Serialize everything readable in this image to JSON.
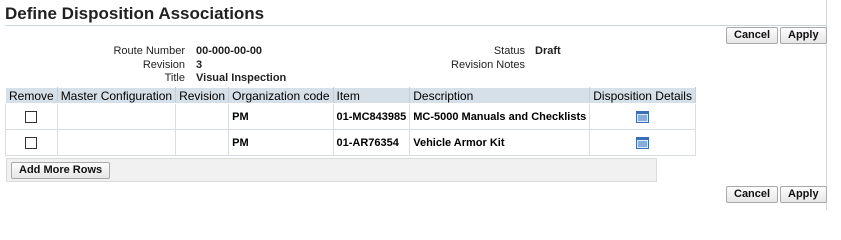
{
  "page": {
    "title": "Define Disposition Associations"
  },
  "actions": {
    "cancel_label": "Cancel",
    "apply_label": "Apply"
  },
  "meta": {
    "route_number_label": "Route Number",
    "route_number": "00-000-00-00",
    "revision_label": "Revision",
    "revision": "3",
    "title_label": "Title",
    "title": "Visual Inspection",
    "status_label": "Status",
    "status": "Draft",
    "revision_notes_label": "Revision Notes",
    "revision_notes": ""
  },
  "table": {
    "headers": {
      "remove": "Remove",
      "master_configuration": "Master Configuration",
      "revision": "Revision",
      "organization_code": "Organization code",
      "item": "Item",
      "description": "Description",
      "disposition_details": "Disposition Details"
    },
    "rows": [
      {
        "master_configuration": "",
        "revision": "",
        "organization_code": "PM",
        "item": "01-MC843985",
        "description": "MC-5000 Manuals and Checklists",
        "remove_checked": false,
        "details_icon": "details-icon"
      },
      {
        "master_configuration": "",
        "revision": "",
        "organization_code": "PM",
        "item": "01-AR76354",
        "description": "Vehicle Armor Kit",
        "remove_checked": false,
        "details_icon": "details-icon"
      }
    ],
    "add_more_rows_label": "Add More Rows"
  },
  "colors": {
    "header_bg": "#d6e0e9",
    "rule": "#c9d4dc",
    "icon_blue": "#3a6fb8"
  }
}
